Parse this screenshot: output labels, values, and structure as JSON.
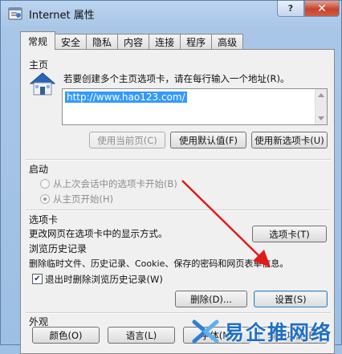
{
  "window": {
    "title": "Internet 属性",
    "help_glyph": "?",
    "close_glyph": "✕"
  },
  "tabs": [
    {
      "label": "常规",
      "active": true
    },
    {
      "label": "安全",
      "active": false
    },
    {
      "label": "隐私",
      "active": false
    },
    {
      "label": "内容",
      "active": false
    },
    {
      "label": "连接",
      "active": false
    },
    {
      "label": "程序",
      "active": false
    },
    {
      "label": "高级",
      "active": false
    }
  ],
  "home": {
    "label": "主页",
    "description": "若要创建多个主页选项卡，请在每行输入一个地址(R)。",
    "url": "http://www.hao123.com/",
    "btn_current": "使用当前页(C)",
    "btn_default": "使用默认值(F)",
    "btn_new_tab": "使用新选项卡(U)"
  },
  "startup": {
    "label": "启动",
    "option_last_session": "从上次会话中的选项卡开始(B)",
    "option_home": "从主页开始(H)"
  },
  "tabs_group": {
    "label": "选项卡",
    "description": "更改网页在选项卡中的显示方式。",
    "btn": "选项卡(T)"
  },
  "history": {
    "label": "浏览历史记录",
    "description": "删除临时文件、历史记录、Cookie、保存的密码和网页表单信息。",
    "checkbox_label": "退出时删除浏览历史记录(W)",
    "checkbox_checked": true,
    "btn_delete": "删除(D)...",
    "btn_settings": "设置(S)"
  },
  "appearance": {
    "label": "外观",
    "btn_colors": "颜色(O)",
    "btn_languages": "语言(L)",
    "btn_fonts": "字体(N)",
    "btn_accessibility": "辅助功能(E)"
  },
  "watermark": {
    "text": "易企推网络"
  },
  "colors": {
    "annotation_arrow": "#e11b1b",
    "selection": "#3399ff",
    "house_roof": "#2a66b8"
  }
}
